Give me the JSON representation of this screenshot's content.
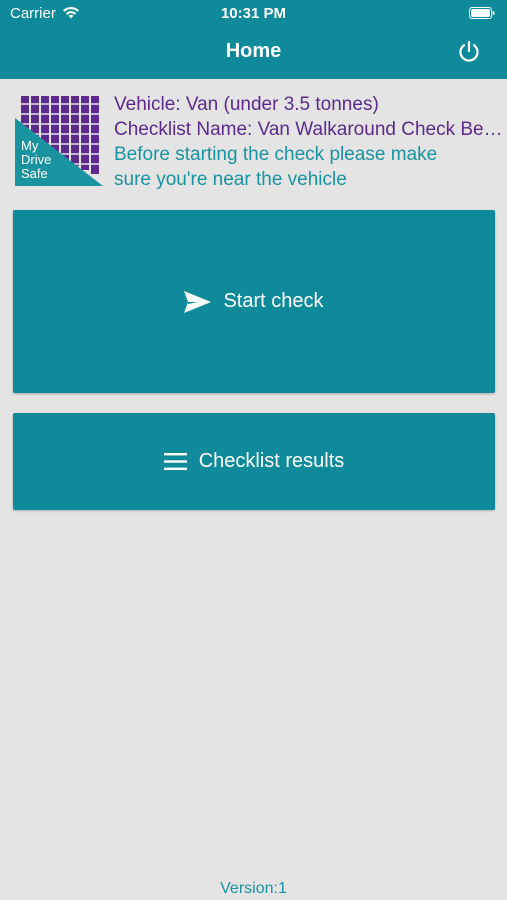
{
  "status_bar": {
    "carrier": "Carrier",
    "time": "10:31 PM"
  },
  "nav": {
    "title": "Home",
    "power_icon": "power-icon"
  },
  "logo": {
    "text_line1": "My",
    "text_line2": "Drive",
    "text_line3": "Safe"
  },
  "info": {
    "vehicle": "Vehicle: Van (under 3.5 tonnes)",
    "checklist_name": "Checklist Name: Van Walkaround Check Before Use",
    "instruction_line1": "Before starting the check please make",
    "instruction_line2": "sure you're near the vehicle"
  },
  "buttons": {
    "start_check": {
      "label": "Start check",
      "icon": "send-icon"
    },
    "checklist_results": {
      "label": "Checklist results",
      "icon": "menu-icon"
    }
  },
  "footer": {
    "version": "Version:1"
  },
  "colors": {
    "primary": "#0e8a9a",
    "purple": "#5b2a8c",
    "teal_text": "#1a93a1",
    "background": "#e4e4e4"
  }
}
